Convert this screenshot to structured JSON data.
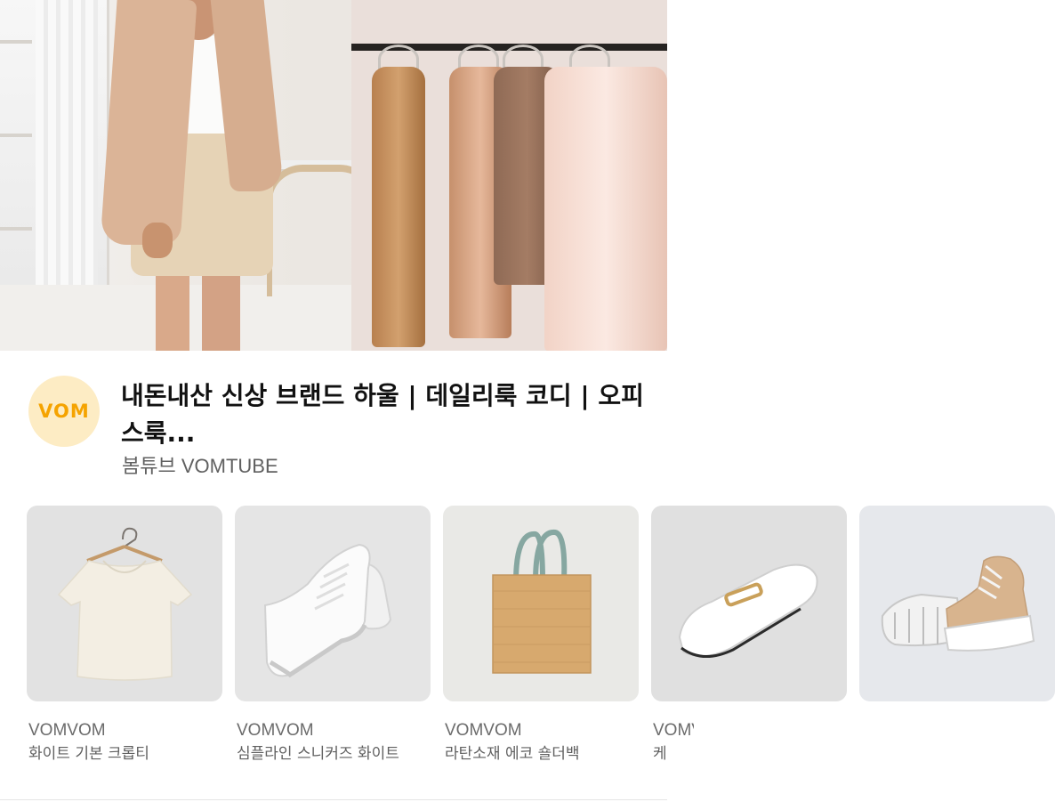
{
  "video": {
    "title": "내돈내산 신상 브랜드 하울 | 데일리룩 코디 | 오피스룩...",
    "channel_name": "봄튜브 VOMTUBE",
    "avatar_text": "VOM"
  },
  "products": [
    {
      "brand": "VOMVOM",
      "name": "화이트 기본 크롭티",
      "icon": "cropped-tee-icon"
    },
    {
      "brand": "VOMVOM",
      "name": "심플라인 스니커즈 화이트",
      "icon": "sneakers-icon"
    },
    {
      "brand": "VOMVOM",
      "name": "라탄소재 에코 숄더백",
      "icon": "tote-bag-icon"
    },
    {
      "brand": "VOMVOM",
      "name": "케",
      "icon": "loafer-mule-icon"
    },
    {
      "brand": "",
      "name": "",
      "icon": "boots-icon"
    }
  ],
  "colors": {
    "avatar_bg": "#fdecc4",
    "avatar_text": "#f5a300",
    "title": "#111111",
    "secondary": "#606060"
  }
}
